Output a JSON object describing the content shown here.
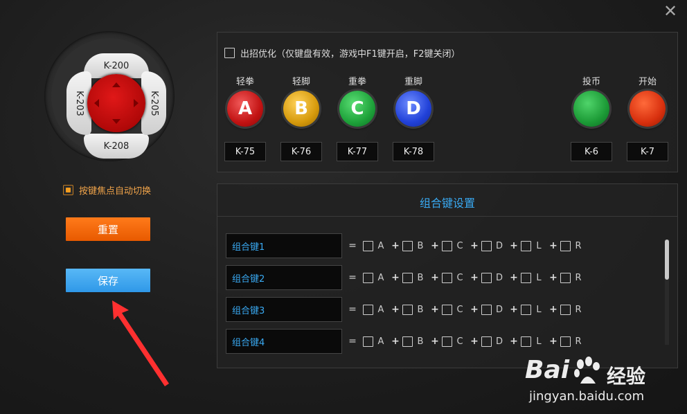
{
  "window": {
    "close_glyph": "✕"
  },
  "dpad": {
    "up": "K-200",
    "down": "K-208",
    "left": "K-203",
    "right": "K-205"
  },
  "focus_toggle": {
    "label": "按键焦点自动切换",
    "checked": true
  },
  "buttons": {
    "reset": "重置",
    "save": "保存"
  },
  "option": {
    "label": "出招优化（仅键盘有效，游戏中F1键开启，F2键关闭）",
    "checked": false
  },
  "game_buttons": [
    {
      "name": "轻拳",
      "letter": "A",
      "key": "K-75"
    },
    {
      "name": "轻脚",
      "letter": "B",
      "key": "K-76"
    },
    {
      "name": "重拳",
      "letter": "C",
      "key": "K-77"
    },
    {
      "name": "重脚",
      "letter": "D",
      "key": "K-78"
    },
    {
      "name": "投币",
      "letter": "",
      "key": "K-6"
    },
    {
      "name": "开始",
      "letter": "",
      "key": "K-7"
    }
  ],
  "combo": {
    "title": "组合键设置",
    "eq": "=",
    "plus": "+",
    "letters": [
      "A",
      "B",
      "C",
      "D",
      "L",
      "R"
    ],
    "rows": [
      "组合键1",
      "组合键2",
      "组合键3",
      "组合键4"
    ]
  },
  "watermark": {
    "brand": "Bai",
    "brand2": "经验",
    "url": "jingyan.baidu.com"
  },
  "colors": {
    "accent_blue": "#39a9f2",
    "orange": "#f39c1f"
  }
}
